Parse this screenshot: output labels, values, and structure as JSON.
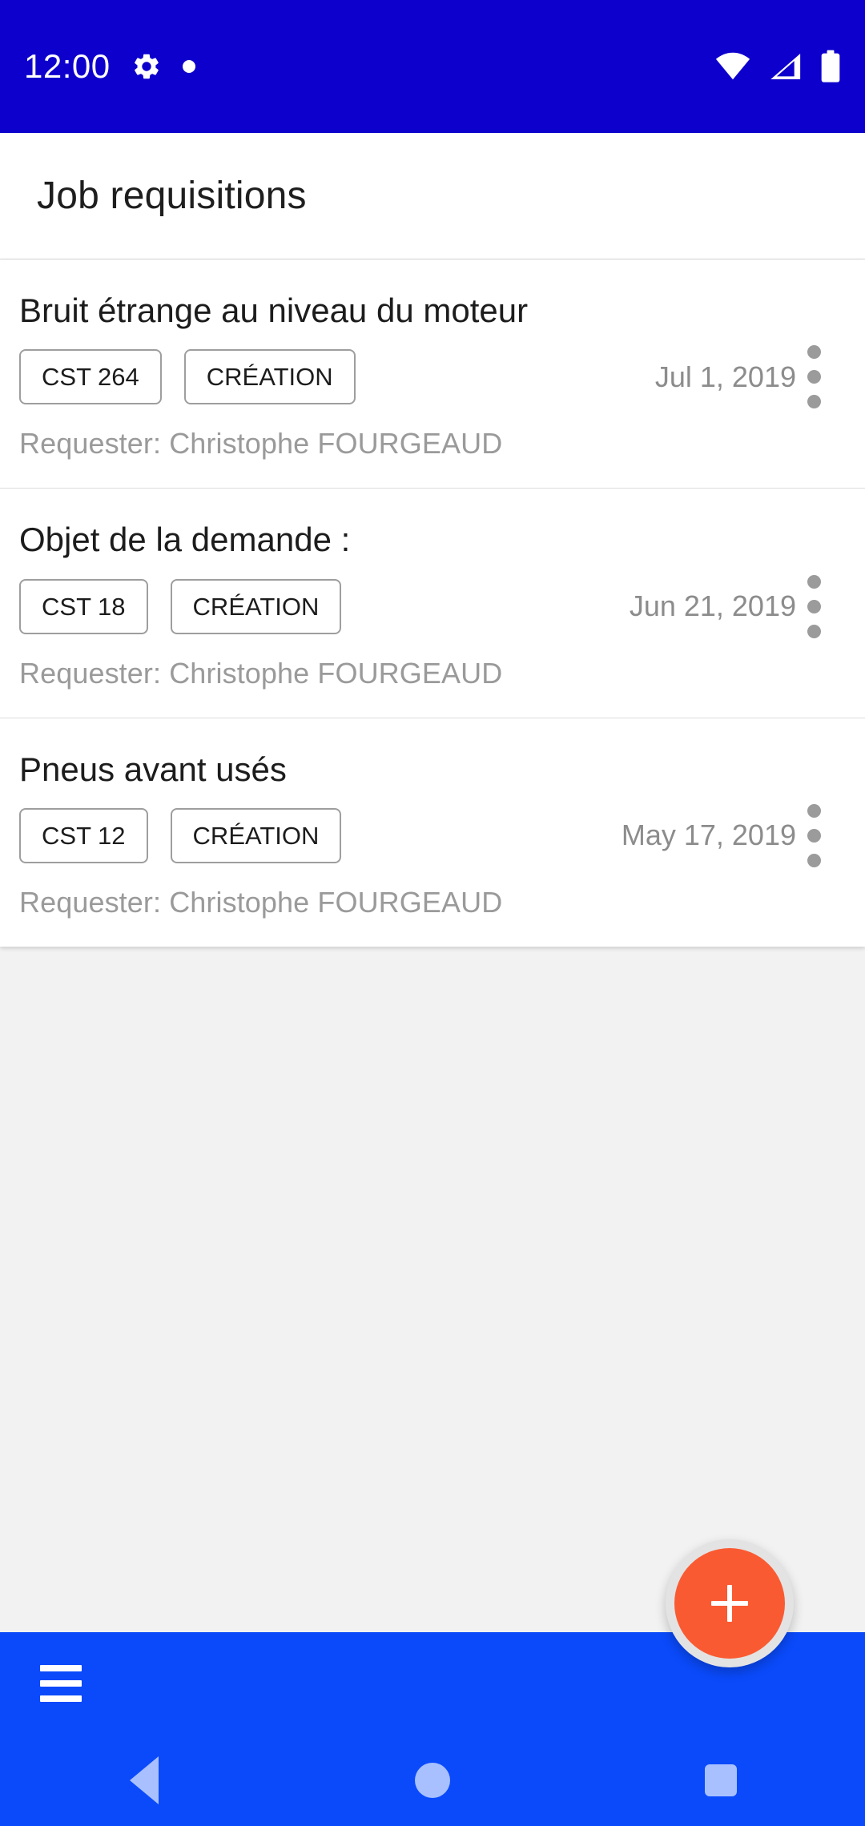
{
  "statusbar": {
    "clock": "12:00",
    "icons": [
      "gear-icon",
      "notification-dot-icon",
      "wifi-icon",
      "cellular-signal-icon",
      "battery-icon"
    ]
  },
  "toolbar": {
    "title": "Job requisitions"
  },
  "list": {
    "items": [
      {
        "title": "Bruit étrange au niveau du moteur",
        "code_chip": "CST 264",
        "status_chip": "CRÉATION",
        "date": "Jul 1, 2019",
        "requester": "Requester: Christophe FOURGEAUD",
        "overflow": "more-options"
      },
      {
        "title": "Objet de la demande :",
        "code_chip": "CST 18",
        "status_chip": "CRÉATION",
        "date": "Jun 21, 2019",
        "requester": "Requester: Christophe FOURGEAUD",
        "overflow": "more-options"
      },
      {
        "title": "Pneus avant usés",
        "code_chip": "CST 12",
        "status_chip": "CRÉATION",
        "date": "May 17, 2019",
        "requester": "Requester: Christophe FOURGEAUD",
        "overflow": "more-options"
      }
    ]
  },
  "bottombar": {
    "menu_icon": "hamburger-menu-icon",
    "fab_icon": "plus-icon"
  },
  "navbar": {
    "back": "back-icon",
    "home": "home-icon",
    "recents": "recents-icon"
  },
  "colors": {
    "statusbar_blue": "#0d00cc",
    "bottombar_blue": "#0a4afa",
    "fab_orange": "#fa5a32",
    "page_background": "#f2f2f2",
    "card_white": "#ffffff",
    "muted_text": "#9a9a9a",
    "nav_icon_blue": "#a8c0ff"
  }
}
